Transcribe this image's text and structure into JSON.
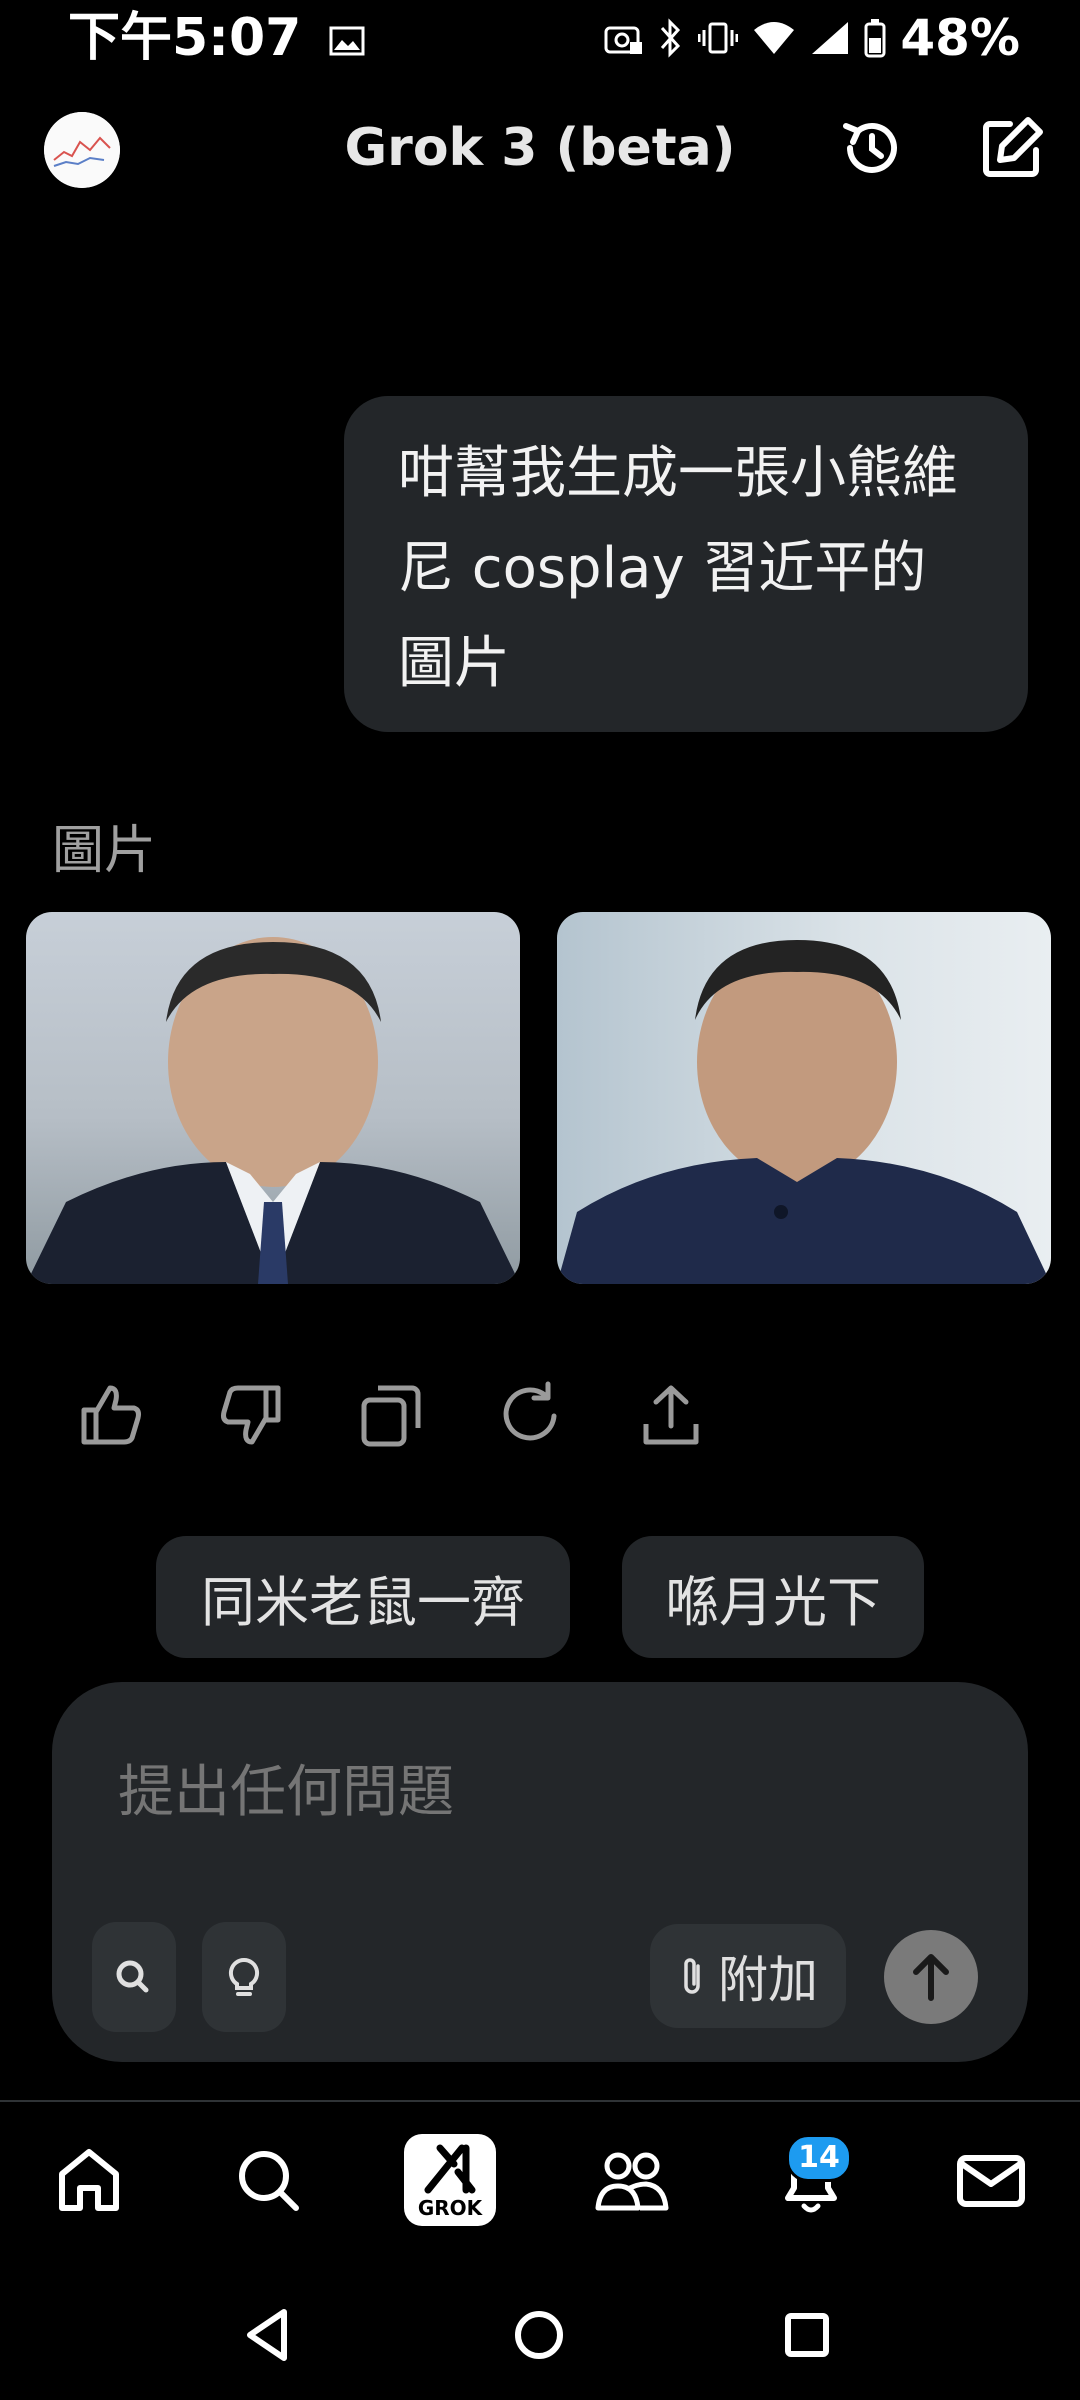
{
  "status_bar": {
    "time": "下午5:07",
    "battery": "48%"
  },
  "header": {
    "title": "Grok 3 (beta)"
  },
  "chat": {
    "user_message": "咁幫我生成一張小熊維尼 cosplay 習近平的圖片",
    "images_label": "圖片"
  },
  "suggestions": [
    "同米老鼠一齊",
    "喺月光下"
  ],
  "composer": {
    "placeholder": "提出任何問題",
    "attach_label": "附加"
  },
  "bottom_nav": {
    "grok_label": "GROK",
    "notifications_count": "14"
  },
  "colors": {
    "background": "#000000",
    "bubble": "#232629",
    "accent_blue": "#1d9bf0"
  }
}
